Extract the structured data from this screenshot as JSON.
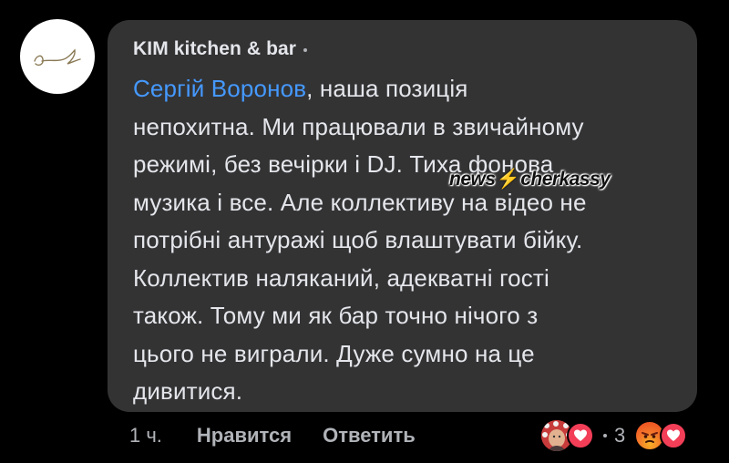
{
  "comment": {
    "author": "KIM kitchen & bar",
    "mention": "Сергій Воронов",
    "lines": [
      ", наша позиція",
      "непохитна. Ми працювали в звичайному",
      "режимі, без вечірки і DJ. Тиха фонова",
      "музика і все. Але коллективу на відео не",
      "потрібні антуражі щоб влаштувати бійку.",
      "Коллектив наляканий, адекватні гості",
      "також. Тому ми як бар точно нічого з",
      "цього не виграли. Дуже сумно на це",
      "дивитися."
    ]
  },
  "watermark": {
    "left": "news",
    "right": "cherkassy"
  },
  "actions": {
    "time": "1 ч.",
    "like_label": "Нравится",
    "reply_label": "Ответить"
  },
  "reactions": {
    "count": "3",
    "icons": [
      "reactor-avatar",
      "love-icon",
      "angry-icon",
      "love-icon"
    ]
  },
  "colors": {
    "background": "#000000",
    "bubble": "#333334",
    "text": "#e4e6eb",
    "secondary_text": "#b0b3b8",
    "mention": "#4599ff",
    "love": "#f33e58"
  }
}
